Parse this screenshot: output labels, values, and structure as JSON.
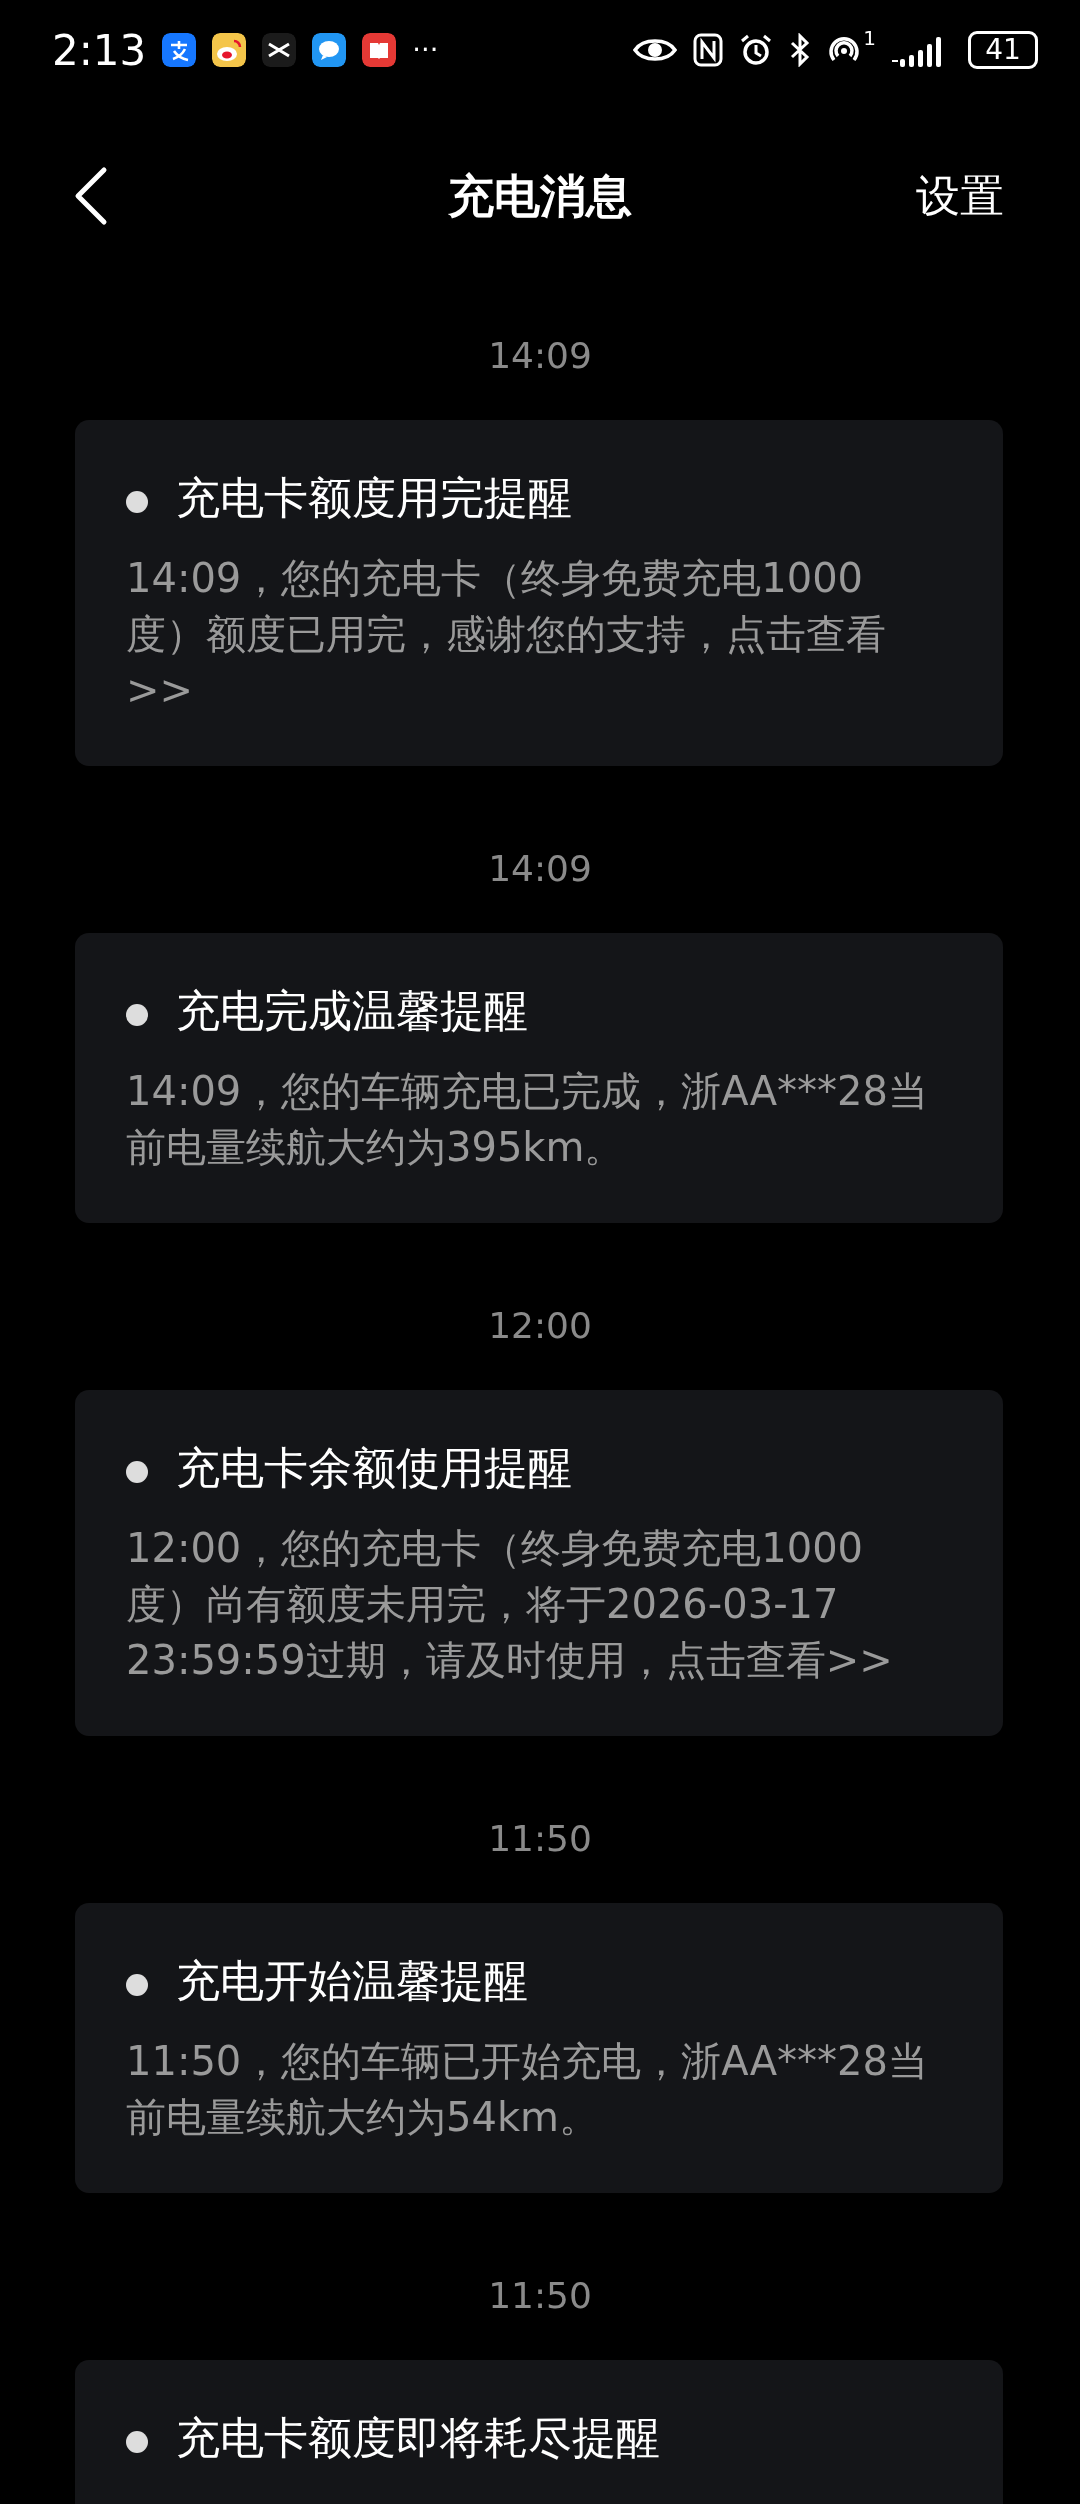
{
  "status_bar": {
    "time": "2:13",
    "more": "···",
    "hotspot_count": "1",
    "battery": "41"
  },
  "header": {
    "title": "充电消息",
    "action": "设置"
  },
  "messages": [
    {
      "time": "14:09",
      "title": "充电卡额度用完提醒",
      "body": "14:09，您的充电卡（终身免费充电1000度）额度已用完，感谢您的支持，点击查看>>"
    },
    {
      "time": "14:09",
      "title": "充电完成温馨提醒",
      "body": "14:09，您的车辆充电已完成，浙AA***28当前电量续航大约为395km。"
    },
    {
      "time": "12:00",
      "title": "充电卡余额使用提醒",
      "body": "12:00，您的充电卡（终身免费充电1000度）尚有额度未用完，将于2026-03-17 23:59:59过期，请及时使用，点击查看>>"
    },
    {
      "time": "11:50",
      "title": "充电开始温馨提醒",
      "body": "11:50，您的车辆已开始充电，浙AA***28当前电量续航大约为54km。"
    },
    {
      "time": "11:50",
      "title": "充电卡额度即将耗尽提醒"
    }
  ]
}
